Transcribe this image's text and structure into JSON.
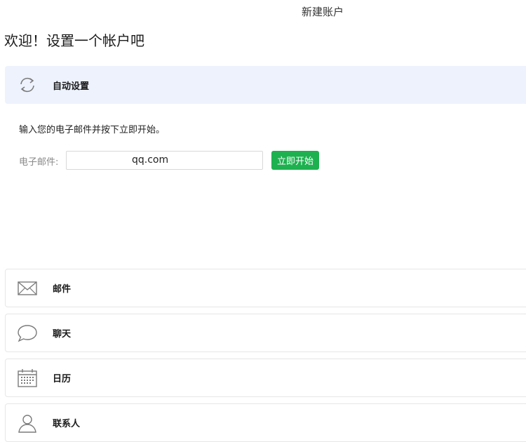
{
  "window": {
    "title": "新建账户"
  },
  "welcome": {
    "heading": "欢迎！设置一个帐户吧"
  },
  "auto_setup": {
    "label": "自动设置",
    "icon": "refresh-icon",
    "instruction": "输入您的电子邮件并按下立即开始。",
    "email_label": "电子邮件:",
    "email_value": "qq.com",
    "start_button": "立即开始"
  },
  "options": [
    {
      "label": "邮件",
      "icon": "mail-icon"
    },
    {
      "label": "聊天",
      "icon": "chat-icon"
    },
    {
      "label": "日历",
      "icon": "calendar-icon"
    },
    {
      "label": "联系人",
      "icon": "contact-icon"
    }
  ],
  "colors": {
    "accent_bg": "#edf2fd",
    "button_green": "#1db14f"
  }
}
